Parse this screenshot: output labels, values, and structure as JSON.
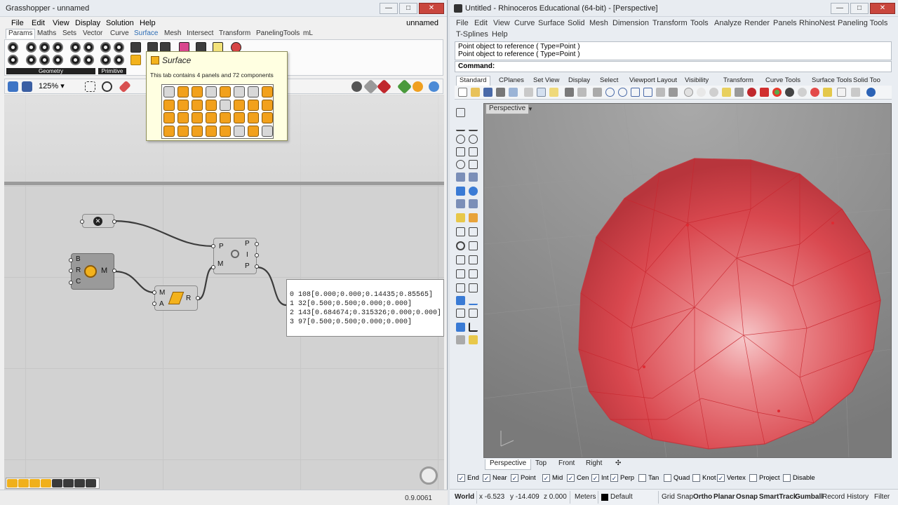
{
  "gh": {
    "title": "Grasshopper - unnamed",
    "doc_name": "unnamed",
    "menu": [
      "File",
      "Edit",
      "View",
      "Display",
      "Solution",
      "Help"
    ],
    "tabs": [
      "Params",
      "Maths",
      "Sets",
      "Vector",
      "Curve",
      "Surface",
      "Mesh",
      "Intersect",
      "Transform",
      "PanelingTools",
      "mL"
    ],
    "active_tab": "Params",
    "hover_tab": "Surface",
    "ribbon_groups": [
      "Geometry",
      "Primitive"
    ],
    "zoom": "125%",
    "tooltip": {
      "title": "Surface",
      "description": "This tab contains 4 panels and 72 components"
    },
    "nodes": {
      "mesh": {
        "inputs": [
          "B",
          "R",
          "C"
        ],
        "output": "M"
      },
      "area": {
        "inputs": [
          "M",
          "A"
        ],
        "output": "R"
      },
      "closest": {
        "inputs": [
          "P",
          "M"
        ],
        "outputs": [
          "P",
          "I",
          "P"
        ]
      }
    },
    "panel_rows": [
      {
        "idx": "0",
        "text": "108[0.000;0.000;0.14435;0.85565]"
      },
      {
        "idx": "1",
        "text": "32[0.500;0.500;0.000;0.000]"
      },
      {
        "idx": "2",
        "text": "143[0.684674;0.315326;0.000;0.000]"
      },
      {
        "idx": "3",
        "text": "97[0.500;0.500;0.000;0.000]"
      }
    ],
    "version": "0.9.0061",
    "colors": {
      "component_orange": "#f3b21c",
      "canvas": "#d2d2d2"
    }
  },
  "rh": {
    "title": "Untitled - Rhinoceros Educational (64-bit) - [Perspective]",
    "menu_row1": [
      "File",
      "Edit",
      "View",
      "Curve",
      "Surface",
      "Solid",
      "Mesh",
      "Dimension",
      "Transform",
      "Tools",
      "Analyze",
      "Render",
      "Panels",
      "RhinoNest",
      "Paneling Tools"
    ],
    "menu_row2": [
      "T-Splines",
      "Help"
    ],
    "history": [
      "Point object to reference ( Type=Point )",
      "Point object to reference ( Type=Point )"
    ],
    "command_label": "Command:",
    "toolbar_tabs": [
      "Standard",
      "CPlanes",
      "Set View",
      "Display",
      "Select",
      "Viewport Layout",
      "Visibility",
      "Transform",
      "Curve Tools",
      "Surface Tools",
      "Solid Too"
    ],
    "active_toolbar_tab": "Standard",
    "viewport_label": "Perspective",
    "viewport_tabs": [
      "Perspective",
      "Top",
      "Front",
      "Right"
    ],
    "osnaps": [
      {
        "label": "End",
        "checked": true
      },
      {
        "label": "Near",
        "checked": true
      },
      {
        "label": "Point",
        "checked": true
      },
      {
        "label": "Mid",
        "checked": true
      },
      {
        "label": "Cen",
        "checked": true
      },
      {
        "label": "Int",
        "checked": true
      },
      {
        "label": "Perp",
        "checked": true
      },
      {
        "label": "Tan",
        "checked": false
      },
      {
        "label": "Quad",
        "checked": false
      },
      {
        "label": "Knot",
        "checked": false
      },
      {
        "label": "Vertex",
        "checked": true
      },
      {
        "label": "Project",
        "checked": false
      },
      {
        "label": "Disable",
        "checked": false
      }
    ],
    "status": {
      "cplane": "World",
      "x": "x -6.523",
      "y": "y -14.409",
      "z": "z 0.000",
      "units": "Meters",
      "layer": "Default",
      "toggles": [
        "Grid Snap",
        "Ortho",
        "Planar",
        "Osnap",
        "SmartTrack",
        "Gumball",
        "Record History",
        "Filter"
      ]
    },
    "colors": {
      "sphere": "#d9484f",
      "viewport_bg": "#8c8c8c"
    }
  }
}
